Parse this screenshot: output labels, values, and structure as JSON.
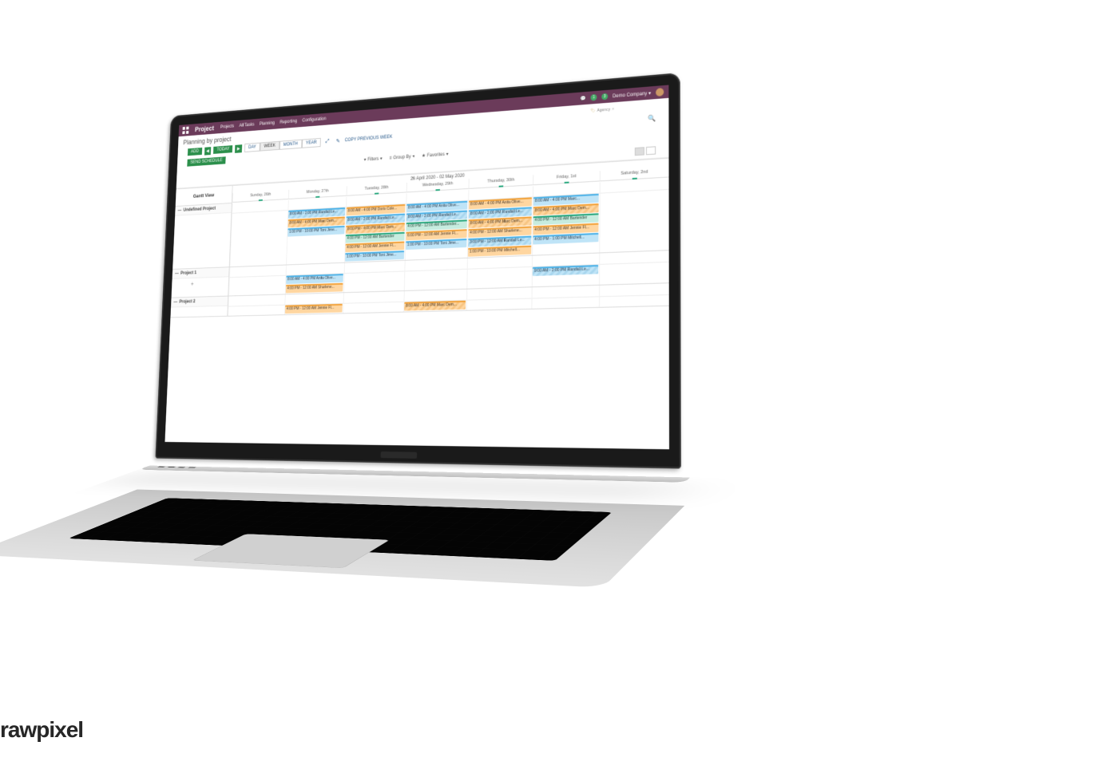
{
  "watermark": "rawpixel",
  "header": {
    "brand": "Project",
    "menu": [
      "Projects",
      "All Tasks",
      "Planning",
      "Reporting",
      "Configuration"
    ],
    "company": "Demo Company",
    "badges": [
      "1",
      "3"
    ]
  },
  "page": {
    "title": "Planning by project",
    "breadcrumb_tag": "Agency"
  },
  "toolbar": {
    "add": "ADD",
    "today": "TODAY",
    "send_schedule": "SEND SCHEDULE",
    "ranges": [
      "DAY",
      "WEEK",
      "MONTH",
      "YEAR"
    ],
    "active_range": "WEEK",
    "copy": "COPY PREVIOUS WEEK",
    "filters": "Filters",
    "groupby": "Group By",
    "favorites": "Favorites"
  },
  "gantt": {
    "view_label": "Gantt View",
    "date_range": "26 April 2020 - 02 May 2020",
    "days": [
      "Sunday, 26th",
      "Monday, 27th",
      "Tuesday, 28th",
      "Wednesday, 29th",
      "Thursday, 30th",
      "Friday, 1st",
      "Saturday, 2nd"
    ],
    "groups": [
      {
        "name": "Undefined Project",
        "rows": [
          [
            null,
            {
              "c": "blue h",
              "t": "8:00 AM - 2:00 PM Randall Le..."
            },
            {
              "c": "orange",
              "t": "8:00 AM - 4:00 PM Doris Cole..."
            },
            {
              "c": "blue",
              "t": "8:00 AM - 4:00 PM Anita Olive..."
            },
            {
              "c": "orange",
              "t": "8:00 AM - 4:00 PM Anita Olive..."
            },
            {
              "c": "blue",
              "t": "8:00 AM - 4:00 PM Marc..."
            },
            null
          ],
          [
            null,
            {
              "c": "orange h",
              "t": "8:00 AM - 4:00 PM Marc Dem..."
            },
            {
              "c": "blue h",
              "t": "8:00 AM - 2:00 PM Randall Le..."
            },
            {
              "c": "blue h",
              "t": "8:00 AM - 2:00 PM Randall Le..."
            },
            {
              "c": "blue h",
              "t": "8:00 AM - 2:00 PM Randall Le..."
            },
            {
              "c": "orange h",
              "t": "8:00 AM - 4:00 PM Marc Dem..."
            },
            null
          ],
          [
            null,
            {
              "c": "blue",
              "t": "1:00 PM - 10:00 PM Toni Jime..."
            },
            {
              "c": "orange h",
              "t": "8:00 PM - 4:00 PM Marc Dem..."
            },
            {
              "c": "teal",
              "t": "4:00 PM - 12:00 AM Bartender..."
            },
            {
              "c": "orange h",
              "t": "8:00 AM - 4:00 PM Marc Dem..."
            },
            {
              "c": "teal",
              "t": "4:00 PM - 12:00 AM Bartender"
            },
            null
          ],
          [
            null,
            null,
            {
              "c": "teal",
              "t": "4:00 PM - 12:00 AM Bartender"
            },
            {
              "c": "orange",
              "t": "6:00 PM - 12:00 AM Jennie Fl..."
            },
            {
              "c": "orange",
              "t": "4:00 PM - 12:00 AM Sharlene..."
            },
            {
              "c": "orange",
              "t": "4:00 PM - 12:00 AM Jennie Fl..."
            },
            null
          ],
          [
            null,
            null,
            {
              "c": "orange",
              "t": "4:00 PM - 12:00 AM Jennie Fl..."
            },
            {
              "c": "blue",
              "t": "1:00 PM - 10:00 PM Toni Jime..."
            },
            {
              "c": "blue h",
              "t": "3:00 PM - 12:00 AM Randall Le..."
            },
            {
              "c": "blue",
              "t": "4:00 PM - 1:00 PM Mitchell..."
            },
            null
          ],
          [
            null,
            null,
            {
              "c": "blue",
              "t": "1:00 PM - 10:00 PM Toni Jime..."
            },
            null,
            {
              "c": "orange",
              "t": "1:00 PM - 10:00 PM Mitchell..."
            },
            null,
            null
          ]
        ]
      },
      {
        "name": "Project 1",
        "rows": [
          [
            null,
            {
              "c": "blue",
              "t": "8:00 AM - 4:00 PM Anita Olive..."
            },
            null,
            null,
            null,
            {
              "c": "blue h",
              "t": "9:00 AM - 2:00 PM Randall Le..."
            },
            null
          ],
          [
            null,
            {
              "c": "orange",
              "t": "4:00 PM - 12:00 AM Sharlene..."
            },
            null,
            null,
            null,
            null,
            null
          ]
        ]
      },
      {
        "name": "Project 2",
        "rows": [
          [
            null,
            {
              "c": "orange",
              "t": "4:00 PM - 12:00 AM Jennie Fl..."
            },
            null,
            {
              "c": "orange h",
              "t": "8:00 AM - 4:00 PM Marc Dem..."
            },
            null,
            null,
            null
          ]
        ]
      }
    ]
  }
}
